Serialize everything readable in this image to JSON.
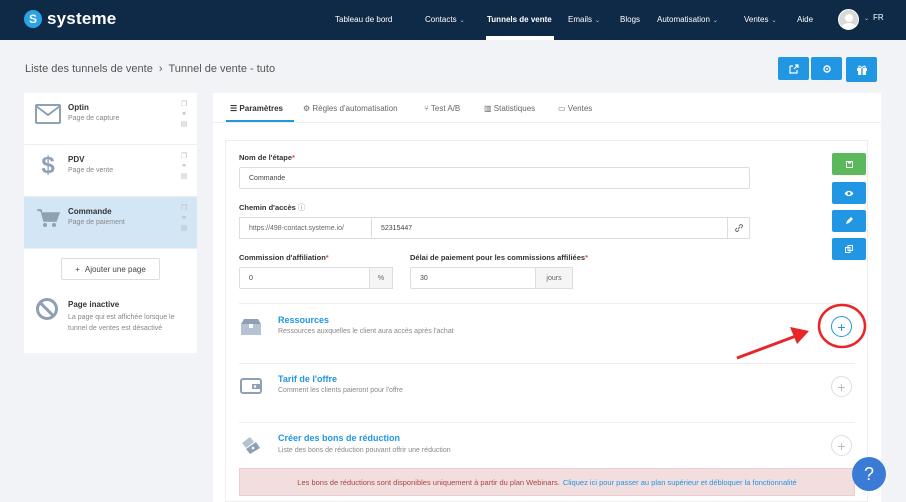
{
  "app": {
    "logo_text": "systeme",
    "logo_letter": "S"
  },
  "nav": {
    "items": [
      {
        "label": "Tableau de bord",
        "caret": false
      },
      {
        "label": "Contacts",
        "caret": true
      },
      {
        "label": "Tunnels de vente",
        "caret": false,
        "active": true
      },
      {
        "label": "Emails",
        "caret": true
      },
      {
        "label": "Blogs",
        "caret": false
      },
      {
        "label": "Automatisation",
        "caret": true
      },
      {
        "label": "Ventes",
        "caret": true
      },
      {
        "label": "Aide",
        "caret": false
      }
    ],
    "lang": "FR",
    "caret_glyph": "⌄"
  },
  "breadcrumb": {
    "parent": "Liste des tunnels de vente",
    "separator": "›",
    "current": "Tunnel de vente - tuto"
  },
  "top_buttons": {
    "open_icon": "external-link-icon",
    "settings_icon": "gear-icon",
    "gift_icon": "gift-icon"
  },
  "steps": [
    {
      "title": "Optin",
      "subtitle": "Page de capture",
      "icon": "envelope-icon"
    },
    {
      "title": "PDV",
      "subtitle": "Page de vente",
      "icon": "dollar-icon"
    },
    {
      "title": "Commande",
      "subtitle": "Page de paiement",
      "icon": "cart-icon",
      "active": true
    }
  ],
  "add_page": {
    "plus": "+",
    "label": "Ajouter une page"
  },
  "inactive": {
    "title": "Page inactive",
    "description": "La page qui est affichée lorsque le tunnel de ventes est désactivé"
  },
  "tabs": [
    {
      "icon": "☰",
      "label": "Paramètres",
      "active": true
    },
    {
      "icon": "⚙",
      "label": "Règles d'automatisation"
    },
    {
      "icon": "⑂",
      "label": "Test A/B"
    },
    {
      "icon": "▥",
      "label": "Statistiques"
    },
    {
      "icon": "▭",
      "label": "Ventes"
    }
  ],
  "form": {
    "step_name_label": "Nom de l'étape",
    "step_name_value": "Commande",
    "path_label": "Chemin d'accès",
    "path_prefix": "https://498-contact.systeme.io/",
    "path_value": "52315447",
    "commission_label": "Commission d'affiliation",
    "commission_value": "0",
    "commission_unit": "%",
    "delay_label": "Délai de paiement pour les commissions affiliées",
    "delay_value": "30",
    "delay_unit": "jours",
    "required_mark": "*"
  },
  "side_buttons": [
    {
      "icon": "save-icon",
      "color": "#5cb85c"
    },
    {
      "icon": "eye-icon",
      "color": "#2196e3"
    },
    {
      "icon": "edit-icon",
      "color": "#2196e3"
    },
    {
      "icon": "copy-icon",
      "color": "#2196e3"
    }
  ],
  "sections": [
    {
      "title": "Ressources",
      "subtitle": "Ressources auxquelles le client aura accès après l'achat",
      "icon": "box-icon"
    },
    {
      "title": "Tarif de l'offre",
      "subtitle": "Comment les clients paieront pour l'offre",
      "icon": "wallet-icon"
    },
    {
      "title": "Créer des bons de réduction",
      "subtitle": "Liste des bons de réduction pouvant offrir une réduction",
      "icon": "coupon-icon"
    }
  ],
  "alert": {
    "text": "Les bons de réductions sont disponibles uniquement à partir du plan Webinars.",
    "link": "Cliquez ici pour passer au plan supérieur et débloquer la fonctionnalité"
  },
  "help": {
    "label": "?"
  },
  "colors": {
    "nav_bg": "#0e2a47",
    "accent": "#2196e3",
    "annotation": "#e8262a",
    "success": "#5cb85c"
  }
}
